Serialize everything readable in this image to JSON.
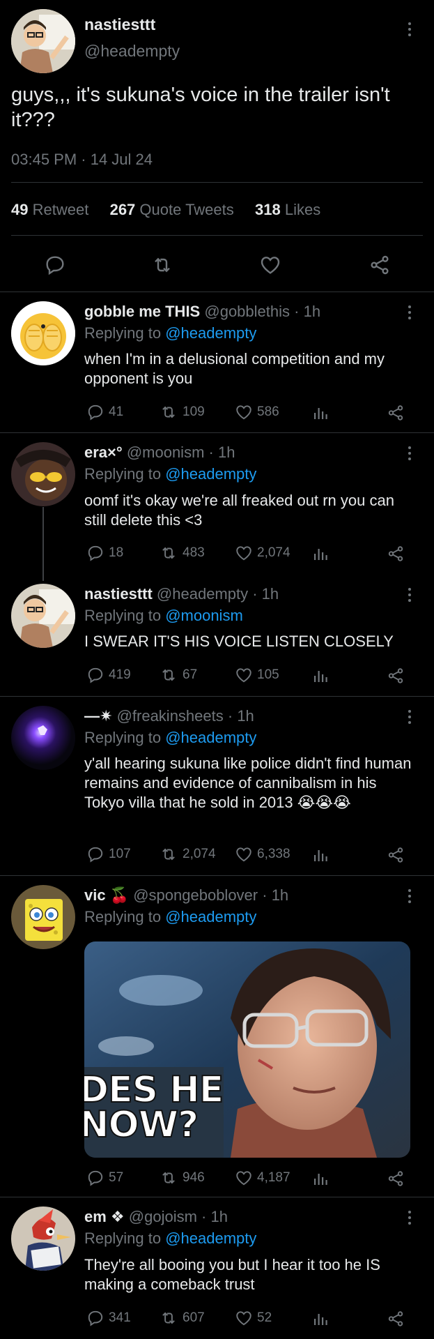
{
  "main_tweet": {
    "display_name": "nastiesttt",
    "handle": "@headempty",
    "text_line1": "guys,,, it's sukuna's voice in the trailer isn't",
    "text_line2": "it???",
    "timestamp": "03:45 PM · 14 Jul 24",
    "retweet_count": "49",
    "retweet_label": "Retweet",
    "quote_count": "267",
    "quote_label": "Quote Tweets",
    "like_count": "318",
    "like_label": "Likes"
  },
  "replies": [
    {
      "display_name": "gobble me THIS",
      "handle": "@gobblethis",
      "time": "· 1h",
      "replying_prefix": "Replying to ",
      "replying_to": "@headempty",
      "text": "when I'm in a delusional competition and my opponent is you",
      "replies": "41",
      "retweets": "109",
      "likes": "586"
    },
    {
      "display_name": "era×°",
      "handle": "@moonism",
      "time": "· 1h",
      "replying_prefix": "Replying to ",
      "replying_to": "@headempty",
      "text": "oomf it's okay we're all freaked out rn you can still delete this <3",
      "replies": "18",
      "retweets": "483",
      "likes": "2,074"
    },
    {
      "display_name": "nastiesttt",
      "handle": "@headempty",
      "time": "· 1h",
      "replying_prefix": "Replying to ",
      "replying_to": "@moonism",
      "text": "I SWEAR IT'S HIS VOICE LISTEN CLOSELY",
      "replies": "419",
      "retweets": "67",
      "likes": "105"
    },
    {
      "display_name": "—✷",
      "handle": "@freakinsheets",
      "time": "· 1h",
      "replying_prefix": "Replying to ",
      "replying_to": "@headempty",
      "text": "y'all hearing sukuna like police didn't find human remains and evidence of cannibalism in his Tokyo villa that he sold in 2013 😭😭😭",
      "replies": "107",
      "retweets": "2,074",
      "likes": "6,338"
    },
    {
      "display_name": "vic 🍒",
      "handle": "@spongeboblover",
      "time": "· 1h",
      "replying_prefix": "Replying to ",
      "replying_to": "@headempty",
      "image_caption_line1": "DES HE",
      "image_caption_line2": "NOW?",
      "replies": "57",
      "retweets": "946",
      "likes": "4,187"
    },
    {
      "display_name": "em ❖",
      "handle": "@gojoism",
      "time": "· 1h",
      "replying_prefix": "Replying to ",
      "replying_to": "@headempty",
      "text": "They're all booing you but I hear it too he IS making a comeback trust",
      "replies": "341",
      "retweets": "607",
      "likes": "52"
    }
  ],
  "icons": {
    "reply": "reply-icon",
    "retweet": "retweet-icon",
    "like": "heart-icon",
    "analytics": "analytics-icon",
    "share": "share-icon",
    "more": "more-icon"
  },
  "colors": {
    "background": "#000000",
    "text": "#e7e9ea",
    "muted": "#71767b",
    "link": "#1d9bf0",
    "divider": "#2f3336"
  }
}
